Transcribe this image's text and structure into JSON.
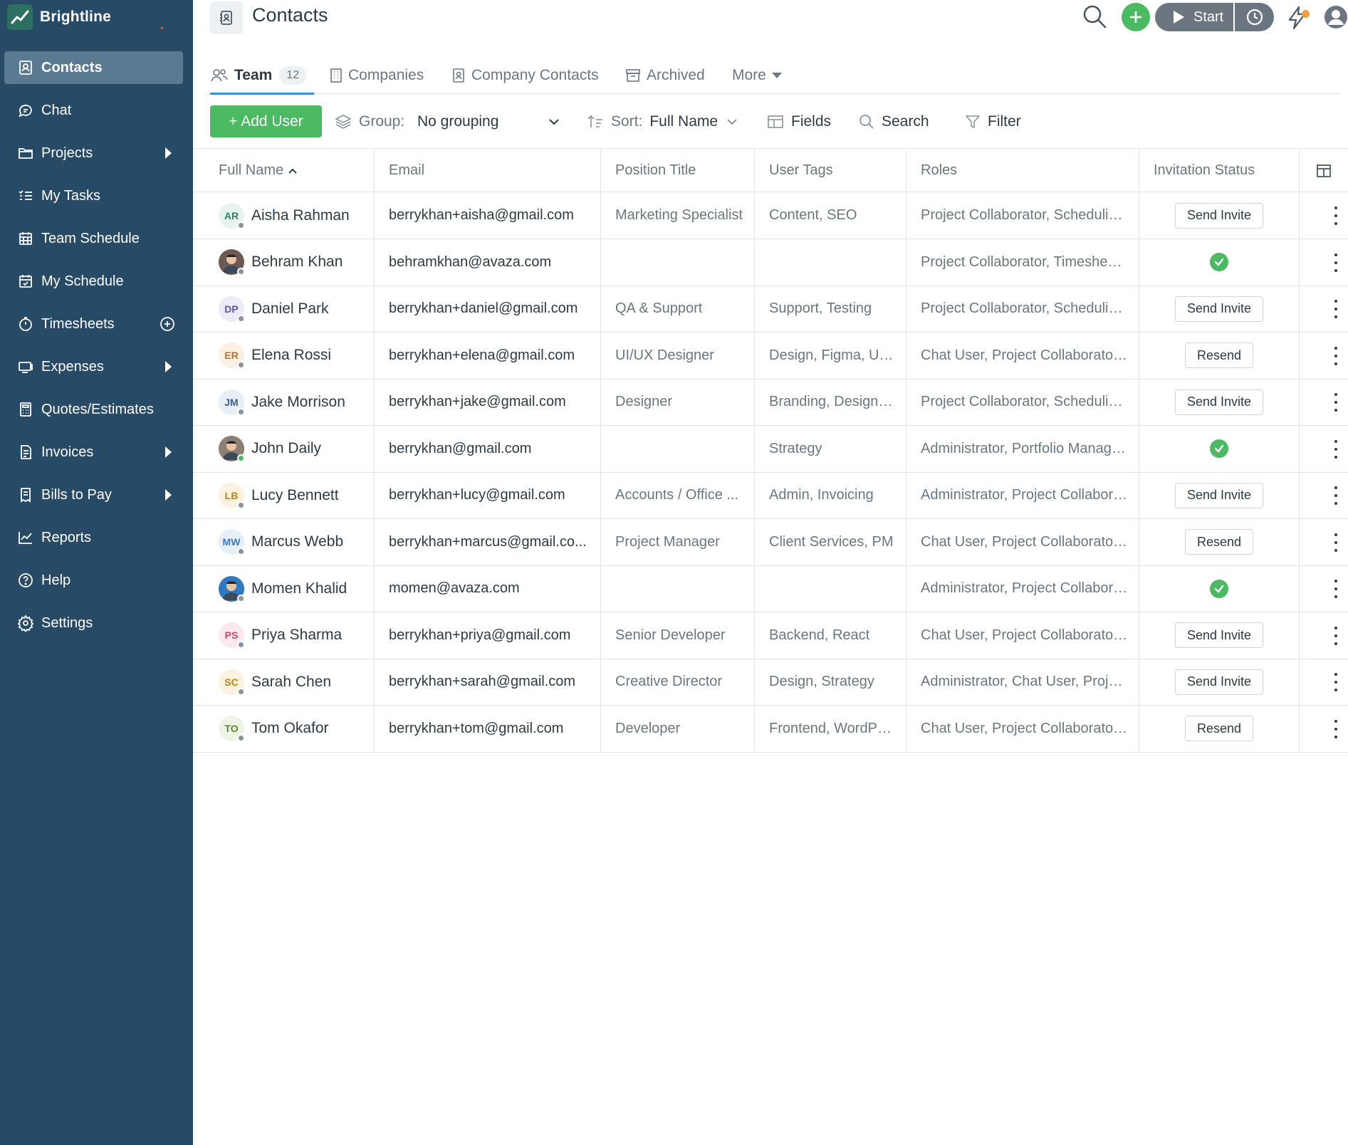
{
  "app": {
    "brand": "Brightline"
  },
  "sidebar": {
    "items": [
      {
        "label": "Contacts",
        "icon": "contacts-icon",
        "active": true
      },
      {
        "label": "Chat",
        "icon": "chat-icon"
      },
      {
        "label": "Projects",
        "icon": "folder-icon",
        "has_submenu": true
      },
      {
        "label": "My Tasks",
        "icon": "tasks-icon"
      },
      {
        "label": "Team Schedule",
        "icon": "calendar-icon"
      },
      {
        "label": "My Schedule",
        "icon": "calendar-check-icon"
      },
      {
        "label": "Timesheets",
        "icon": "stopwatch-icon",
        "has_add": true
      },
      {
        "label": "Expenses",
        "icon": "receipt-icon",
        "has_submenu": true
      },
      {
        "label": "Quotes/Estimates",
        "icon": "calculator-icon"
      },
      {
        "label": "Invoices",
        "icon": "invoice-icon",
        "has_submenu": true
      },
      {
        "label": "Bills to Pay",
        "icon": "bill-icon",
        "has_submenu": true
      },
      {
        "label": "Reports",
        "icon": "chart-icon"
      },
      {
        "label": "Help",
        "icon": "help-icon"
      },
      {
        "label": "Settings",
        "icon": "gear-icon"
      }
    ]
  },
  "header": {
    "title": "Contacts",
    "start_label": "Start"
  },
  "tabs": [
    {
      "label": "Team",
      "count": "12",
      "active": true
    },
    {
      "label": "Companies"
    },
    {
      "label": "Company Contacts"
    },
    {
      "label": "Archived"
    },
    {
      "label": "More"
    }
  ],
  "toolbar": {
    "add_user": "+ Add User",
    "group_label": "Group:",
    "group_value": "No grouping",
    "sort_label": "Sort:",
    "sort_value": "Full Name",
    "fields_label": "Fields",
    "search_label": "Search",
    "filter_label": "Filter"
  },
  "table": {
    "columns": [
      "Full Name",
      "Email",
      "Position Title",
      "User Tags",
      "Roles",
      "Invitation Status"
    ],
    "rows": [
      {
        "initials": "AR",
        "name": "Aisha Rahman",
        "email": "berrykhan+aisha@gmail.com",
        "position": "Marketing Specialist",
        "tags": "Content, SEO",
        "roles": "Project Collaborator, Scheduling...",
        "status": "Send Invite",
        "avatar_bg": "#e6f3ef",
        "avatar_fg": "#2f7f6a",
        "online": false
      },
      {
        "initials": "",
        "name": "Behram Khan",
        "email": "behramkhan@avaza.com",
        "position": "",
        "tags": "",
        "roles": "Project Collaborator, Timesheet ...",
        "status": "accepted",
        "avatar_bg": "#6b5b52",
        "avatar_fg": "#ffffff",
        "online": false,
        "photo": true
      },
      {
        "initials": "DP",
        "name": "Daniel Park",
        "email": "berrykhan+daniel@gmail.com",
        "position": "QA & Support",
        "tags": "Support, Testing",
        "roles": "Project Collaborator, Scheduling...",
        "status": "Send Invite",
        "avatar_bg": "#ecebf7",
        "avatar_fg": "#5a56a8",
        "online": false
      },
      {
        "initials": "ER",
        "name": "Elena Rossi",
        "email": "berrykhan+elena@gmail.com",
        "position": "UI/UX Designer",
        "tags": "Design, Figma, UX ...",
        "roles": "Chat User, Project Collaborator, ...",
        "status": "Resend",
        "avatar_bg": "#fbf0e4",
        "avatar_fg": "#c0702a",
        "online": false
      },
      {
        "initials": "JM",
        "name": "Jake Morrison",
        "email": "berrykhan+jake@gmail.com",
        "position": "Designer",
        "tags": "Branding, Design, I...",
        "roles": "Project Collaborator, Scheduling...",
        "status": "Send Invite",
        "avatar_bg": "#e8eef6",
        "avatar_fg": "#3d5f8a",
        "online": false
      },
      {
        "initials": "",
        "name": "John Daily",
        "email": "berrykhan@gmail.com",
        "position": "",
        "tags": "Strategy",
        "roles": "Administrator, Portfolio Manage...",
        "status": "accepted",
        "avatar_bg": "#8c7f74",
        "avatar_fg": "#ffffff",
        "online": true,
        "photo": true
      },
      {
        "initials": "LB",
        "name": "Lucy Bennett",
        "email": "berrykhan+lucy@gmail.com",
        "position": "Accounts / Office ...",
        "tags": "Admin, Invoicing",
        "roles": "Administrator, Project Collabora...",
        "status": "Send Invite",
        "avatar_bg": "#fbf2e2",
        "avatar_fg": "#b88420",
        "online": false
      },
      {
        "initials": "MW",
        "name": "Marcus Webb",
        "email": "berrykhan+marcus@gmail.co...",
        "position": "Project Manager",
        "tags": "Client Services, PM",
        "roles": "Chat User, Project Collaborator, ...",
        "status": "Resend",
        "avatar_bg": "#e7f0f9",
        "avatar_fg": "#3a7abf",
        "online": false
      },
      {
        "initials": "",
        "name": "Momen Khalid",
        "email": "momen@avaza.com",
        "position": "",
        "tags": "",
        "roles": "Administrator, Project Collabora...",
        "status": "accepted",
        "avatar_bg": "#2f79c4",
        "avatar_fg": "#ffffff",
        "online": false,
        "photo": true
      },
      {
        "initials": "PS",
        "name": "Priya Sharma",
        "email": "berrykhan+priya@gmail.com",
        "position": "Senior Developer",
        "tags": "Backend, React",
        "roles": "Chat User, Project Collaborator, ...",
        "status": "Send Invite",
        "avatar_bg": "#fbe9ee",
        "avatar_fg": "#c04a6a",
        "online": false
      },
      {
        "initials": "SC",
        "name": "Sarah Chen",
        "email": "berrykhan+sarah@gmail.com",
        "position": "Creative Director",
        "tags": "Design, Strategy",
        "roles": "Administrator, Chat User, Projec...",
        "status": "Send Invite",
        "avatar_bg": "#fbf3df",
        "avatar_fg": "#b8861a",
        "online": false
      },
      {
        "initials": "TO",
        "name": "Tom Okafor",
        "email": "berrykhan+tom@gmail.com",
        "position": "Developer",
        "tags": "Frontend, WordPre...",
        "roles": "Chat User, Project Collaborator, ...",
        "status": "Resend",
        "avatar_bg": "#eef4e6",
        "avatar_fg": "#5a8a2a",
        "online": false
      }
    ]
  },
  "colors": {
    "sidebar_bg": "#274a66",
    "accent_green": "#4cb963",
    "tab_underline": "#3a8fd8"
  }
}
